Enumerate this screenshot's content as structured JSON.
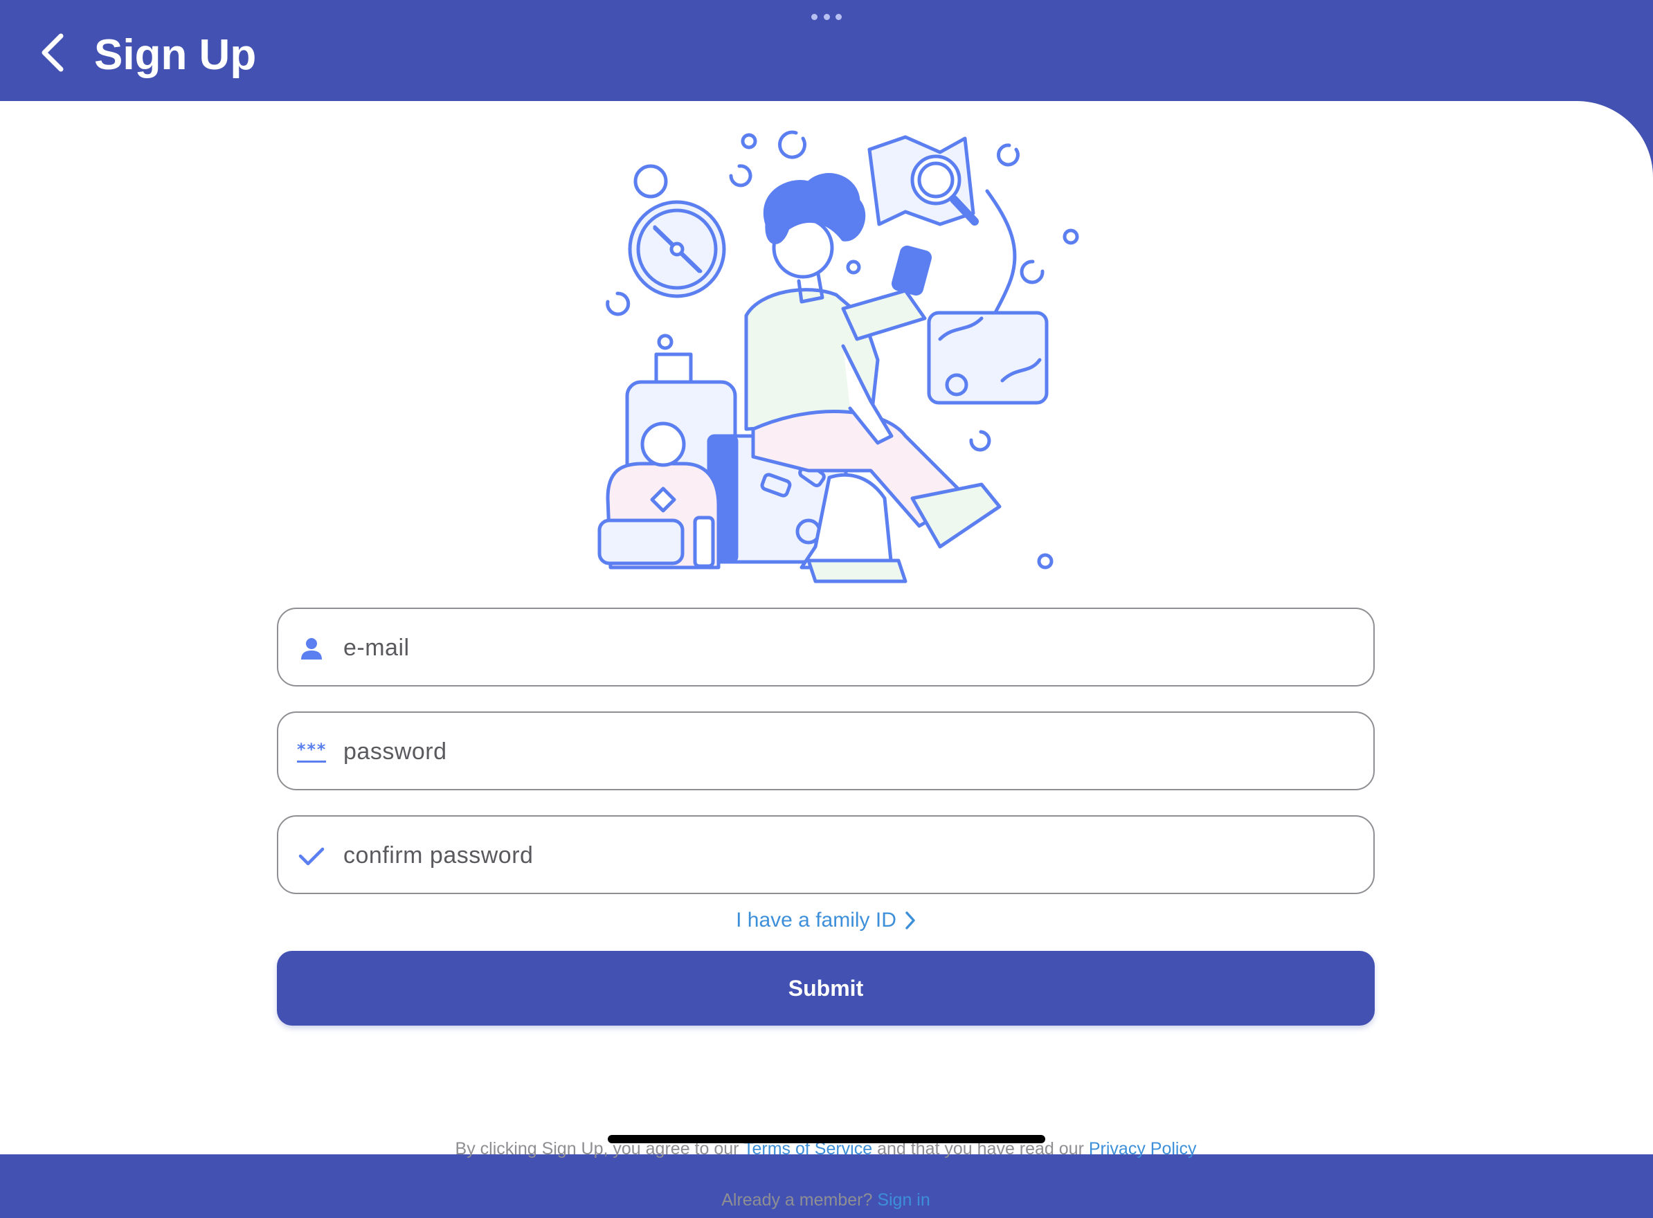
{
  "header": {
    "title": "Sign Up",
    "background_color": "#4352b2",
    "back_icon": "chevron-left-icon"
  },
  "illustration": {
    "icon": "traveler-with-luggage-illustration",
    "accent_color": "#5b7ff0"
  },
  "form": {
    "email": {
      "placeholder": "e-mail",
      "value": "",
      "icon": "person-icon"
    },
    "password": {
      "placeholder": "password",
      "value": "",
      "icon": "password-asterisks-icon"
    },
    "confirm_password": {
      "placeholder": "confirm password",
      "value": "",
      "icon": "checkmark-icon"
    }
  },
  "family_link": {
    "label": "I have a family ID",
    "icon": "chevron-right-icon"
  },
  "submit": {
    "label": "Submit"
  },
  "legal": {
    "prefix": "By clicking Sign Up, you agree to our ",
    "terms_label": "Terms of Service",
    "middle": " and that you have read our ",
    "privacy_label": "Privacy Policy"
  },
  "signin": {
    "prompt": "Already a member? ",
    "link_label": "Sign in"
  },
  "colors": {
    "primary": "#4352b2",
    "link": "#3d8fd9",
    "icon_accent": "#5b7ff0",
    "muted_text": "#8e8e93"
  }
}
